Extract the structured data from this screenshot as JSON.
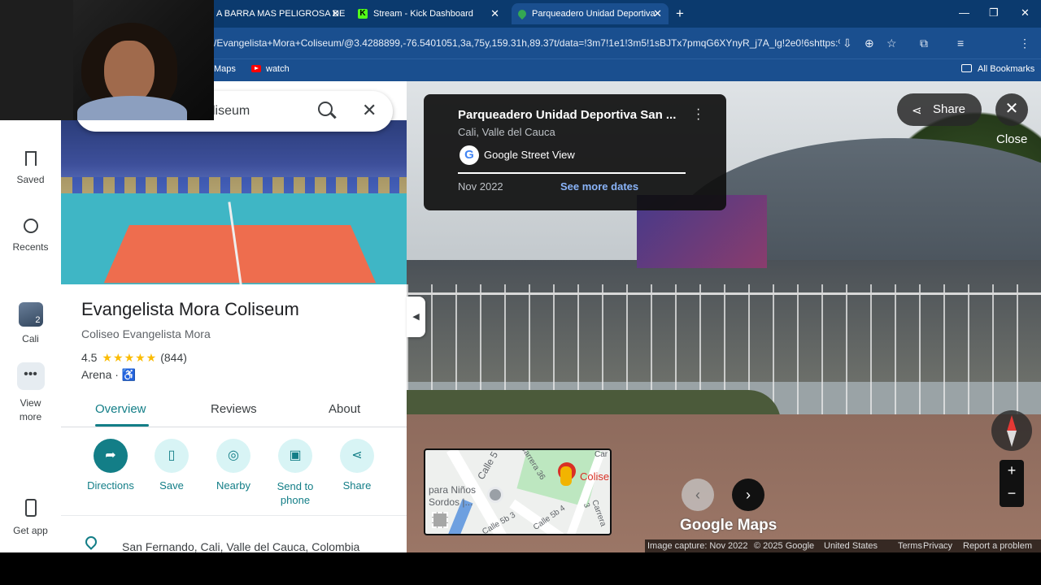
{
  "browser": {
    "tabs": [
      {
        "title": "A BARRA MAS PELIGROSA DE",
        "active": false
      },
      {
        "title": "Stream - Kick Dashboard",
        "active": false
      },
      {
        "title": "Parqueadero Unidad Deportiva",
        "active": true
      }
    ],
    "url": "/Evangelista+Mora+Coliseum/@3.4288899,-76.5401051,3a,75y,159.31h,89.37t/data=!3m7!1e1!3m5!1sBJTx7pmqG6XYnyR_j7A_lg!2e0!6shttps:%2F%2...",
    "bookmarks": [
      "Maps",
      "watch"
    ],
    "all_bookmarks_label": "All Bookmarks"
  },
  "rail": {
    "saved": "Saved",
    "recents": "Recents",
    "recent_place": "Cali",
    "recent_badge": "2",
    "view_more": "View more",
    "get_app": "Get app"
  },
  "place": {
    "search_text": "liseum",
    "name": "Evangelista Mora Coliseum",
    "local_name": "Coliseo Evangelista Mora",
    "rating": "4.5",
    "stars": "★★★★★",
    "review_count": "(844)",
    "category": "Arena",
    "separator": "·",
    "tabs": [
      "Overview",
      "Reviews",
      "About"
    ],
    "actions": [
      "Directions",
      "Save",
      "Nearby",
      "Send to phone",
      "Share"
    ],
    "address": "San Fernando, Cali, Valle del Cauca, Colombia"
  },
  "streetview": {
    "title": "Parqueadero Unidad Deportiva San ...",
    "subtitle": "Cali, Valle del Cauca",
    "provider": "Google Street View",
    "capture_date": "Nov 2022",
    "see_more_dates": "See more dates",
    "share": "Share",
    "close": "Close",
    "brand": "Google Maps",
    "minimap": {
      "place_label": "Colise",
      "label_ninos": "para Niños",
      "label_sordos": "Sordos |...",
      "streets": [
        "Calle 5",
        "Carrera 36",
        "Calle 5b 3",
        "Calle 5b 4",
        "Carrera 3",
        "Car"
      ]
    },
    "footer": {
      "image_capture": "Image capture: Nov 2022",
      "copyright": "© 2025 Google",
      "region": "United States",
      "terms": "Terms",
      "privacy": "Privacy",
      "report": "Report a problem"
    }
  },
  "colors": {
    "accent": "#137e87",
    "chrome": "#1a4f8f",
    "star": "#fbbc04"
  }
}
